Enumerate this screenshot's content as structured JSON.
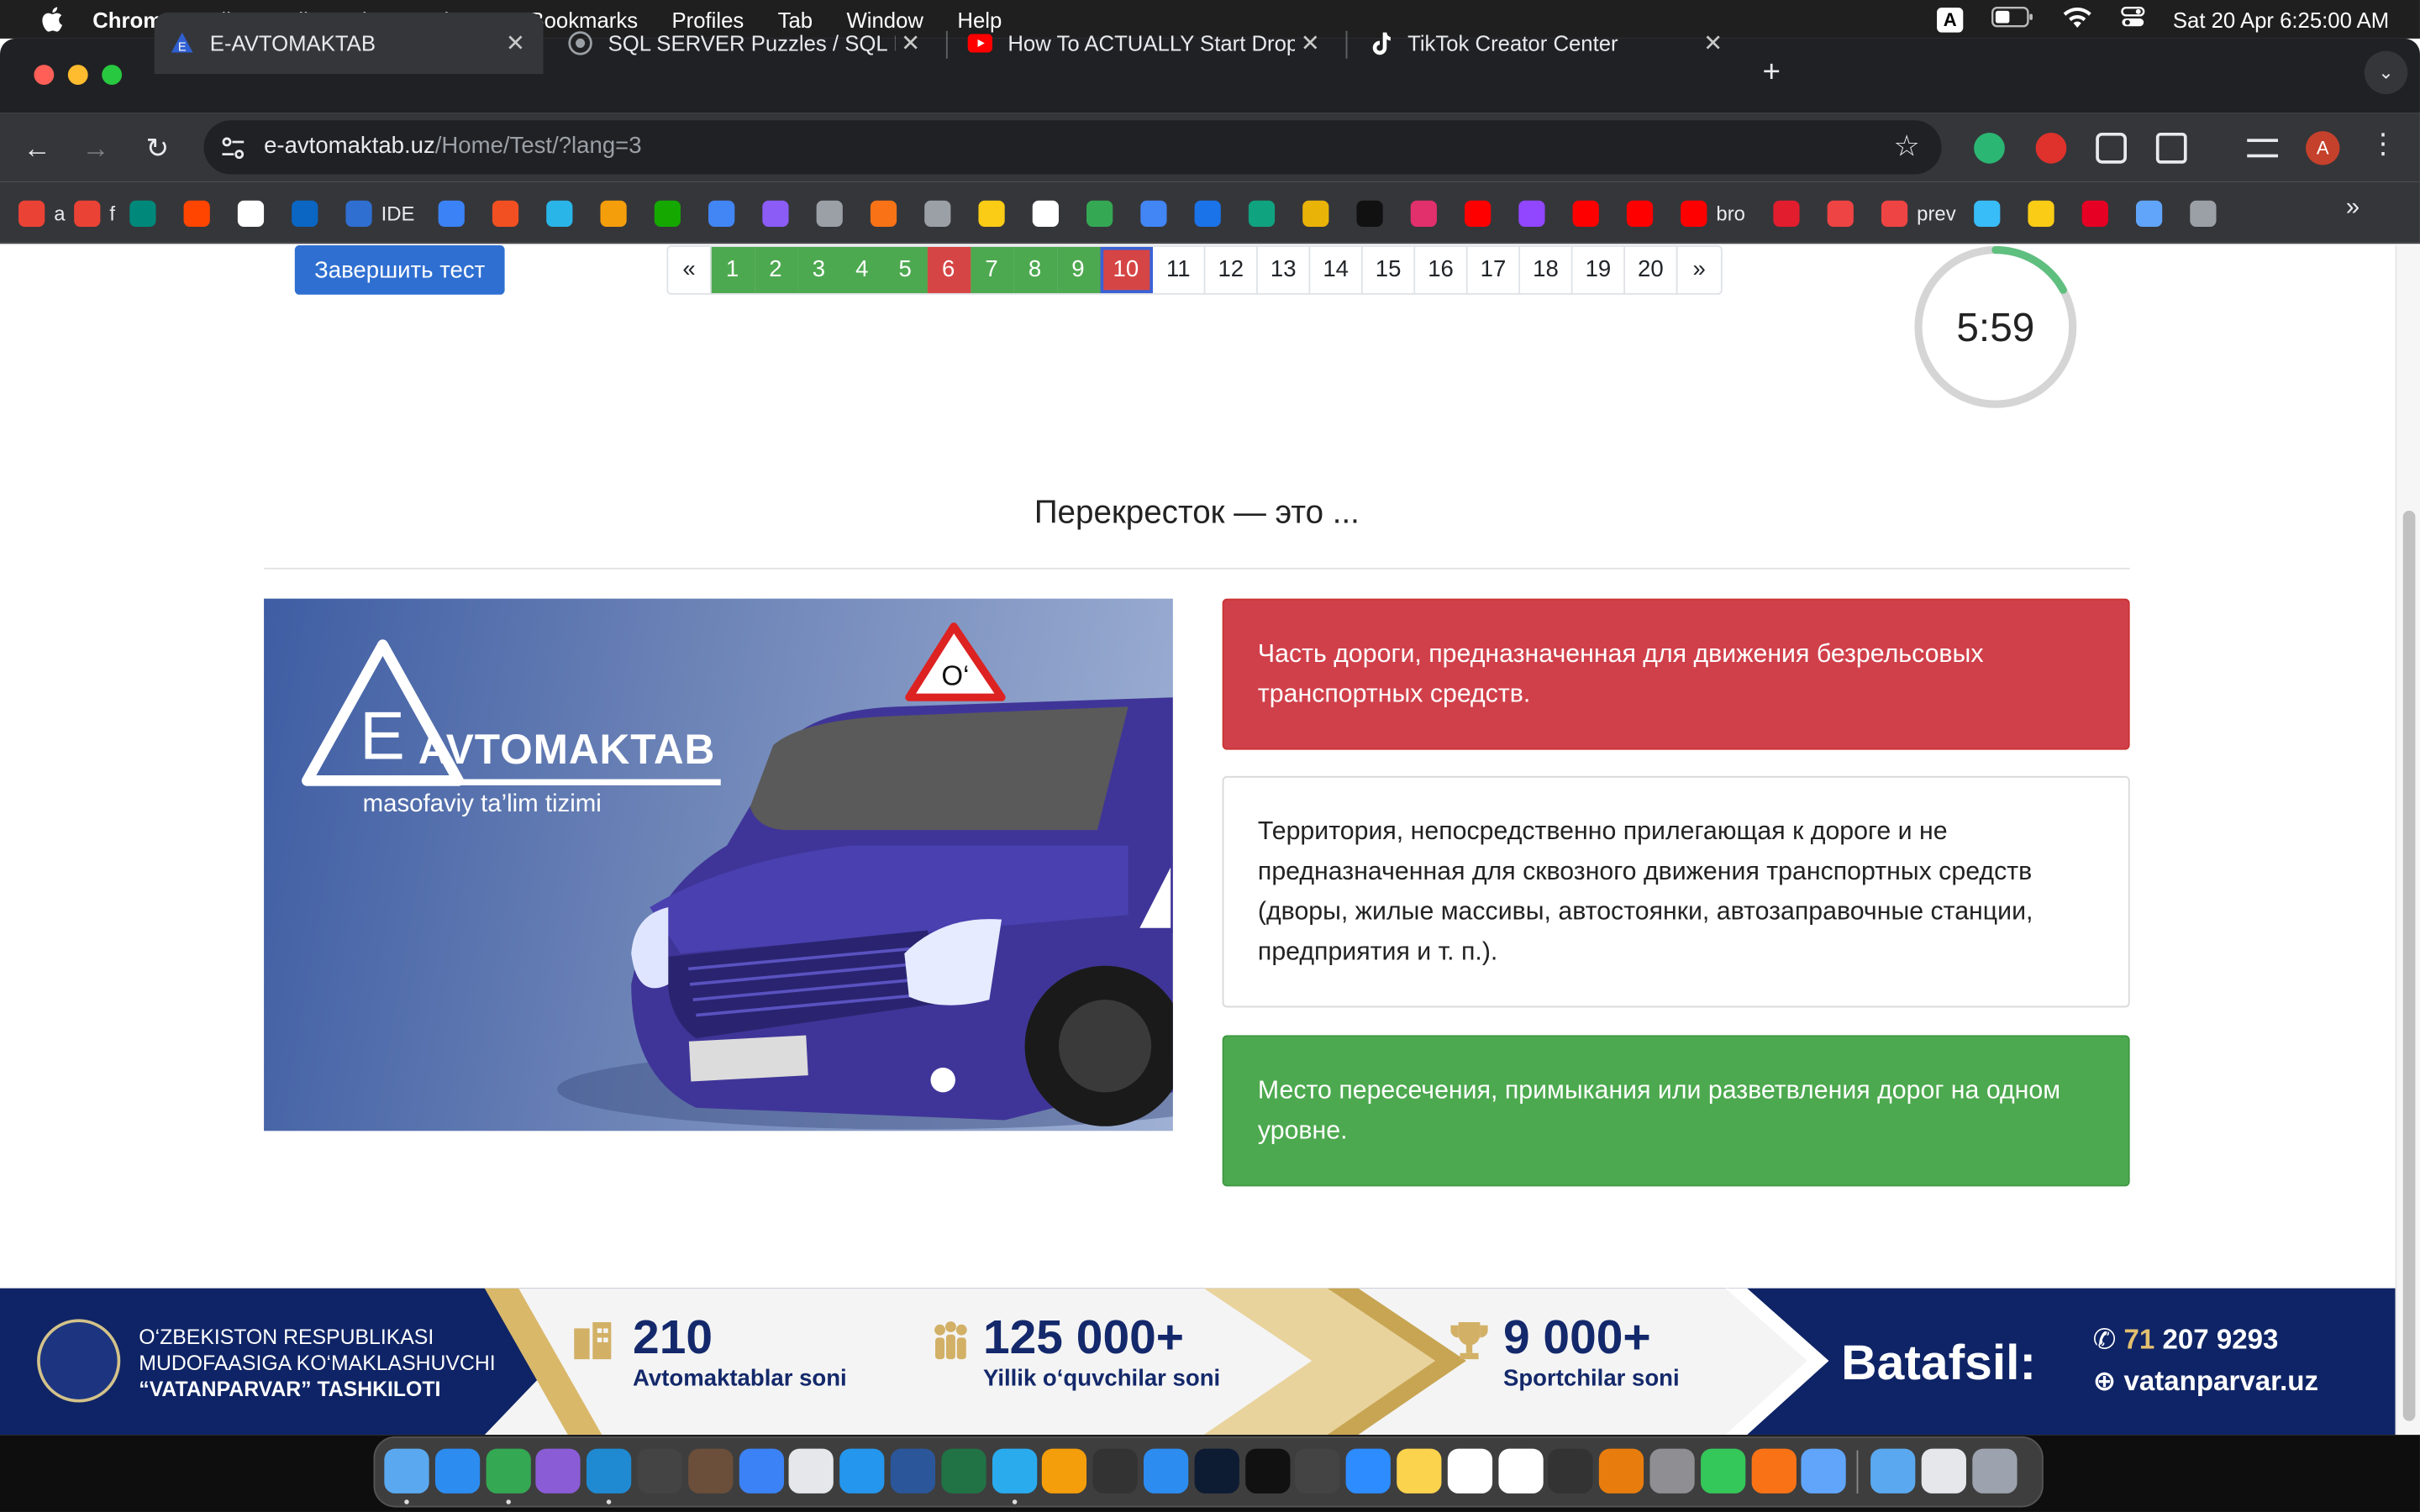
{
  "menubar": {
    "app_name": "Chrome",
    "items": [
      "File",
      "Edit",
      "View",
      "History",
      "Bookmarks",
      "Profiles",
      "Tab",
      "Window",
      "Help"
    ],
    "ime": "A",
    "datetime": "Sat 20 Apr  6:25:00 AM"
  },
  "tabs": [
    {
      "title": "E-AVTOMAKTAB",
      "close": "✕"
    },
    {
      "title": "SQL SERVER Puzzles / SQL P",
      "close": "✕"
    },
    {
      "title": "How To ACTUALLY Start Drop",
      "close": "✕"
    },
    {
      "title": "TikTok Creator Center",
      "close": "✕"
    }
  ],
  "toolbar": {
    "url_host": "e-avtomaktab.uz",
    "url_path": "/Home/Test/?lang=3",
    "profile_initial": "A"
  },
  "bookmarks": [
    {
      "label": "a",
      "icon": "gmail-icon",
      "color": "#ea4335"
    },
    {
      "label": "f",
      "icon": "gmail-icon",
      "color": "#ea4335"
    },
    {
      "label": "",
      "icon": "meet-icon",
      "color": "#00897b"
    },
    {
      "label": "",
      "icon": "reddit-icon",
      "color": "#ff4500"
    },
    {
      "label": "",
      "icon": "github-icon",
      "color": "#ffffff"
    },
    {
      "label": "",
      "icon": "linkedin-icon",
      "color": "#0a66c2"
    },
    {
      "label": "IDE",
      "icon": "sql-icon",
      "color": "#2f6fd1"
    },
    {
      "label": "",
      "icon": "dev-icon",
      "color": "#3b82f6"
    },
    {
      "label": "",
      "icon": "microsoft-icon",
      "color": "#f25022"
    },
    {
      "label": "",
      "icon": "snowflake-icon",
      "color": "#29b5e8"
    },
    {
      "label": "",
      "icon": "box-icon",
      "color": "#f59e0b"
    },
    {
      "label": "",
      "icon": "upwork-icon",
      "color": "#14a800"
    },
    {
      "label": "",
      "icon": "docs-icon",
      "color": "#4285f4"
    },
    {
      "label": "",
      "icon": "purple-icon",
      "color": "#8b5cf6"
    },
    {
      "label": "",
      "icon": "globe-icon",
      "color": "#9aa0a6"
    },
    {
      "label": "",
      "icon": "runner-icon",
      "color": "#f97316"
    },
    {
      "label": "",
      "icon": "hd-icon",
      "color": "#9aa0a6"
    },
    {
      "label": "",
      "icon": "smiley-icon",
      "color": "#facc15"
    },
    {
      "label": "",
      "icon": "google-icon",
      "color": "#ffffff"
    },
    {
      "label": "",
      "icon": "maps-icon",
      "color": "#34a853"
    },
    {
      "label": "",
      "icon": "analytics-icon",
      "color": "#4285f4"
    },
    {
      "label": "",
      "icon": "chat-icon",
      "color": "#1a73e8"
    },
    {
      "label": "",
      "icon": "chatgpt-icon",
      "color": "#10a37f"
    },
    {
      "label": "",
      "icon": "mt-icon",
      "color": "#eab308"
    },
    {
      "label": "",
      "icon": "tiktok-icon",
      "color": "#111111"
    },
    {
      "label": "",
      "icon": "instagram-icon",
      "color": "#e1306c"
    },
    {
      "label": "",
      "icon": "youtube-icon",
      "color": "#ff0000"
    },
    {
      "label": "",
      "icon": "twitch-icon",
      "color": "#9146ff"
    },
    {
      "label": "",
      "icon": "youtube-icon",
      "color": "#ff0000"
    },
    {
      "label": "",
      "icon": "youtube-icon",
      "color": "#ff0000"
    },
    {
      "label": "bro",
      "icon": "youtube-icon",
      "color": "#ff0000"
    },
    {
      "label": "",
      "icon": "v-icon",
      "color": "#e11d2e"
    },
    {
      "label": "",
      "icon": "bar-chart-icon",
      "color": "#ef4444"
    },
    {
      "label": "prev",
      "icon": "bar-chart-icon",
      "color": "#ef4444"
    },
    {
      "label": "",
      "icon": "c-icon",
      "color": "#38bdf8"
    },
    {
      "label": "",
      "icon": "tiles-icon",
      "color": "#facc15"
    },
    {
      "label": "",
      "icon": "pinterest-icon",
      "color": "#e60023"
    },
    {
      "label": "",
      "icon": "sparkle-icon",
      "color": "#60a5fa"
    },
    {
      "label": "",
      "icon": "globe-icon",
      "color": "#9aa0a6"
    }
  ],
  "test": {
    "finish_label": "Завершить тест",
    "pager": [
      {
        "label": "«",
        "state": "plain"
      },
      {
        "label": "1",
        "state": "ok"
      },
      {
        "label": "2",
        "state": "ok"
      },
      {
        "label": "3",
        "state": "ok"
      },
      {
        "label": "4",
        "state": "ok"
      },
      {
        "label": "5",
        "state": "ok"
      },
      {
        "label": "6",
        "state": "bad"
      },
      {
        "label": "7",
        "state": "ok"
      },
      {
        "label": "8",
        "state": "ok"
      },
      {
        "label": "9",
        "state": "ok"
      },
      {
        "label": "10",
        "state": "bad current"
      },
      {
        "label": "11",
        "state": "plain"
      },
      {
        "label": "12",
        "state": "plain"
      },
      {
        "label": "13",
        "state": "plain"
      },
      {
        "label": "14",
        "state": "plain"
      },
      {
        "label": "15",
        "state": "plain"
      },
      {
        "label": "16",
        "state": "plain"
      },
      {
        "label": "17",
        "state": "plain"
      },
      {
        "label": "18",
        "state": "plain"
      },
      {
        "label": "19",
        "state": "plain"
      },
      {
        "label": "20",
        "state": "plain"
      },
      {
        "label": "»",
        "state": "plain"
      }
    ],
    "timer_text": "5:59",
    "timer_progress": 0.17,
    "question": "Перекресток — это ...",
    "image_logo_word": "AVTOMAKTAB",
    "image_logo_letter": "E",
    "image_logo_sub": "masofaviy ta’lim tizimi",
    "image_sign_letter": "O‘",
    "answers": [
      {
        "text": "Часть дороги, предназначенная для движения безрельсовых транспортных средств.",
        "state": "wrong"
      },
      {
        "text": "Территория, непосредственно прилегающая к дороге и не предназначенная для сквозного движения транспортных средств (дворы, жилые массивы, автостоянки, автозаправочные станции, предприятия и т. п.).",
        "state": "neutral"
      },
      {
        "text": "Место пересечения, примыкания или разветвления дорог на одном уровне.",
        "state": "correct"
      }
    ]
  },
  "banner": {
    "org_line1": "O‘ZBEKISTON RESPUBLIKASI",
    "org_line2": "MUDOFAASIGA KO‘MAKLASHUVCHI",
    "org_line3": "“VATANPARVAR” TASHKILOTI",
    "stats": [
      {
        "value": "210",
        "label": "Avtomaktablar soni",
        "icon": "buildings-icon"
      },
      {
        "value": "125 000+",
        "label": "Yillik o‘quvchilar soni",
        "icon": "people-icon"
      },
      {
        "value": "9 000+",
        "label": "Sportchilar soni",
        "icon": "trophy-icon"
      }
    ],
    "cta": "Batafsil:",
    "phone_prefix": "71",
    "phone": "207 9293",
    "website": "vatanparvar.uz"
  },
  "dock": {
    "apps": [
      {
        "icon": "finder-icon",
        "color": "#5aa9f0"
      },
      {
        "icon": "safari-icon",
        "color": "#2d8cf0"
      },
      {
        "icon": "chrome-icon",
        "color": "#34a853"
      },
      {
        "icon": "visual-studio-icon",
        "color": "#8a5cd6"
      },
      {
        "icon": "vscode-icon",
        "color": "#1f8ad2"
      },
      {
        "icon": "textedit-icon",
        "color": "#444444"
      },
      {
        "icon": "app-icon",
        "color": "#6b4f3a"
      },
      {
        "icon": "app-icon",
        "color": "#3b82f6"
      },
      {
        "icon": "app-icon",
        "color": "#e5e7eb"
      },
      {
        "icon": "docker-icon",
        "color": "#2496ed"
      },
      {
        "icon": "word-icon",
        "color": "#2b579a"
      },
      {
        "icon": "excel-icon",
        "color": "#217346"
      },
      {
        "icon": "telegram-icon",
        "color": "#2aabee"
      },
      {
        "icon": "pages-icon",
        "color": "#f59e0b"
      },
      {
        "icon": "obs-icon",
        "color": "#333333"
      },
      {
        "icon": "keynote-icon",
        "color": "#2d8cf0"
      },
      {
        "icon": "photoshop-icon",
        "color": "#0d1b33"
      },
      {
        "icon": "capcut-icon",
        "color": "#111111"
      },
      {
        "icon": "claquette-icon",
        "color": "#444444"
      },
      {
        "icon": "zoom-icon",
        "color": "#2d8cff"
      },
      {
        "icon": "notes-icon",
        "color": "#fcd34d"
      },
      {
        "icon": "notion-icon",
        "color": "#ffffff"
      },
      {
        "icon": "calendar-icon",
        "color": "#ffffff"
      },
      {
        "icon": "unity-icon",
        "color": "#333333"
      },
      {
        "icon": "blender-icon",
        "color": "#e87d0d"
      },
      {
        "icon": "settings-icon",
        "color": "#8e8e93"
      },
      {
        "icon": "facetime-icon",
        "color": "#34c759"
      },
      {
        "icon": "vlc-icon",
        "color": "#f97316"
      },
      {
        "icon": "quicktime-icon",
        "color": "#60a5fa"
      },
      {
        "icon": "downloads-folder-icon",
        "color": "#5aa9f0"
      },
      {
        "icon": "screenshot-icon",
        "color": "#e5e7eb"
      },
      {
        "icon": "trash-icon",
        "color": "#9ca3af"
      }
    ]
  }
}
